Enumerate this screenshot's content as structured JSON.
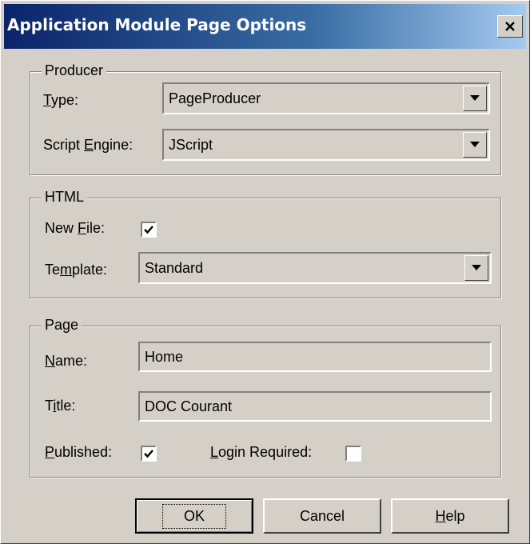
{
  "window": {
    "title": "Application Module Page Options",
    "close_glyph": "close-icon"
  },
  "producer": {
    "legend": "Producer",
    "type_label_u": "T",
    "type_label_rest": "ype:",
    "type_value": "PageProducer",
    "script_label_pre": "Script ",
    "script_label_u": "E",
    "script_label_rest": "ngine:",
    "script_value": "JScript"
  },
  "html": {
    "legend": "HTML",
    "newfile_pre": "New ",
    "newfile_u": "F",
    "newfile_rest": "ile:",
    "newfile_checked": true,
    "template_pre": "Te",
    "template_u": "m",
    "template_rest": "plate:",
    "template_value": "Standard"
  },
  "page": {
    "legend": "Page",
    "name_u": "N",
    "name_rest": "ame:",
    "name_value": "Home",
    "title_pre": "T",
    "title_u": "i",
    "title_rest": "tle:",
    "title_value": "DOC Courant",
    "published_u": "P",
    "published_rest": "ublished:",
    "published_checked": true,
    "login_u": "L",
    "login_rest": "ogin Required:",
    "login_checked": false
  },
  "buttons": {
    "ok": "OK",
    "cancel": "Cancel",
    "help_u": "H",
    "help_rest": "elp"
  }
}
